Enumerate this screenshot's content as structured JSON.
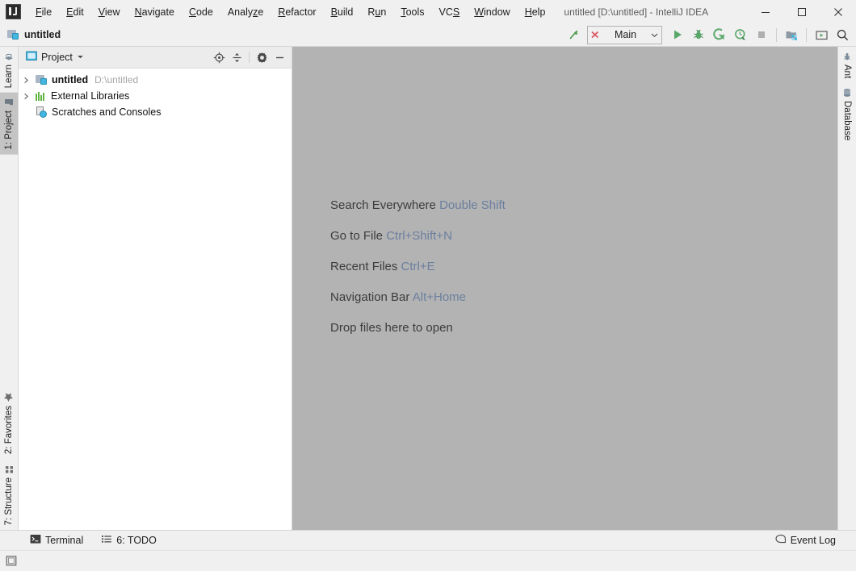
{
  "window": {
    "title": "untitled [D:\\untitled] - IntelliJ IDEA",
    "logo_icon": "intellij-idea-logo-icon",
    "minimize_label": "Minimize",
    "maximize_label": "Maximize",
    "close_label": "Close"
  },
  "menu": {
    "items": [
      {
        "label": "File",
        "mnemonic": "F"
      },
      {
        "label": "Edit",
        "mnemonic": "E"
      },
      {
        "label": "View",
        "mnemonic": "V"
      },
      {
        "label": "Navigate",
        "mnemonic": "N"
      },
      {
        "label": "Code",
        "mnemonic": "C"
      },
      {
        "label": "Analyze",
        "mnemonic": "z"
      },
      {
        "label": "Refactor",
        "mnemonic": "R"
      },
      {
        "label": "Build",
        "mnemonic": "B"
      },
      {
        "label": "Run",
        "mnemonic": "u"
      },
      {
        "label": "Tools",
        "mnemonic": "T"
      },
      {
        "label": "VCS",
        "mnemonic": "S"
      },
      {
        "label": "Window",
        "mnemonic": "W"
      },
      {
        "label": "Help",
        "mnemonic": "H"
      }
    ]
  },
  "navbar": {
    "project_name": "untitled",
    "module_icon": "module-icon"
  },
  "toolbar": {
    "update_project_icon": "update-project-arrow-icon",
    "run_config": {
      "label": "Main",
      "status_icon": "error-cross-icon",
      "dropdown_icon": "chevron-down-icon"
    },
    "buttons": [
      {
        "name": "run-button",
        "icon": "play-icon",
        "label": "Run"
      },
      {
        "name": "debug-button",
        "icon": "bug-icon",
        "label": "Debug"
      },
      {
        "name": "run-with-coverage-button",
        "icon": "coverage-icon",
        "label": "Run with Coverage"
      },
      {
        "name": "profile-button",
        "icon": "profiler-icon",
        "label": "Profile"
      },
      {
        "name": "stop-button",
        "icon": "stop-square-icon",
        "label": "Stop"
      }
    ],
    "right_buttons": [
      {
        "name": "project-structure-button",
        "icon": "project-structure-icon",
        "label": "Project Structure"
      },
      {
        "name": "run-anything-button",
        "icon": "run-anything-icon",
        "label": "Run Anything"
      },
      {
        "name": "search-everywhere-button",
        "icon": "search-icon",
        "label": "Search Everywhere"
      }
    ]
  },
  "left_stripe": {
    "top": [
      {
        "label": "Learn",
        "icon": "learn-icon",
        "active": false
      },
      {
        "label": "1: Project",
        "icon": "project-folder-icon",
        "active": true
      }
    ],
    "bottom": [
      {
        "label": "2: Favorites",
        "icon": "star-icon",
        "active": false
      },
      {
        "label": "7: Structure",
        "icon": "structure-grid-icon",
        "active": false
      }
    ]
  },
  "right_stripe": {
    "items": [
      {
        "label": "Ant",
        "icon": "ant-icon",
        "active": false
      },
      {
        "label": "Database",
        "icon": "database-icon",
        "active": false
      }
    ]
  },
  "project_panel": {
    "header": {
      "icon": "project-view-icon",
      "title": "Project",
      "dropdown_icon": "chevron-down-icon",
      "actions": [
        {
          "name": "select-opened-file-button",
          "icon": "locate-crosshair-icon"
        },
        {
          "name": "collapse-all-button",
          "icon": "collapse-all-icon"
        },
        {
          "name": "tool-window-settings-button",
          "icon": "gear-icon"
        },
        {
          "name": "hide-tool-window-button",
          "icon": "minimize-icon"
        }
      ]
    },
    "tree": [
      {
        "label": "untitled",
        "sublabel": "D:\\untitled",
        "icon": "module-icon",
        "bold": true,
        "expandable": true,
        "expanded": false
      },
      {
        "label": "External Libraries",
        "sublabel": "",
        "icon": "library-icon",
        "bold": false,
        "expandable": true,
        "expanded": false
      },
      {
        "label": "Scratches and Consoles",
        "sublabel": "",
        "icon": "scratches-icon",
        "bold": false,
        "expandable": false,
        "expanded": false
      }
    ]
  },
  "editor": {
    "background_color": "#b3b3b3",
    "hints": [
      {
        "text": "Search Everywhere",
        "shortcut": "Double Shift"
      },
      {
        "text": "Go to File",
        "shortcut": "Ctrl+Shift+N"
      },
      {
        "text": "Recent Files",
        "shortcut": "Ctrl+E"
      },
      {
        "text": "Navigation Bar",
        "shortcut": "Alt+Home"
      },
      {
        "text": "Drop files here to open",
        "shortcut": ""
      }
    ]
  },
  "bottom_bar": {
    "tabs": [
      {
        "label": "Terminal",
        "icon": "terminal-icon"
      },
      {
        "label": "6: TODO",
        "icon": "todo-list-icon"
      }
    ],
    "event_log": {
      "label": "Event Log",
      "icon": "event-log-icon"
    }
  },
  "status_bar": {
    "layout_icon": "tool-window-layout-icon"
  },
  "colors": {
    "accent_blue": "#40b6e0",
    "run_green": "#59a869",
    "error_red": "#db5860",
    "shortcut_text": "#6b7f9e",
    "editor_bg": "#b3b3b3",
    "panel_bg": "#f0f0f0"
  }
}
